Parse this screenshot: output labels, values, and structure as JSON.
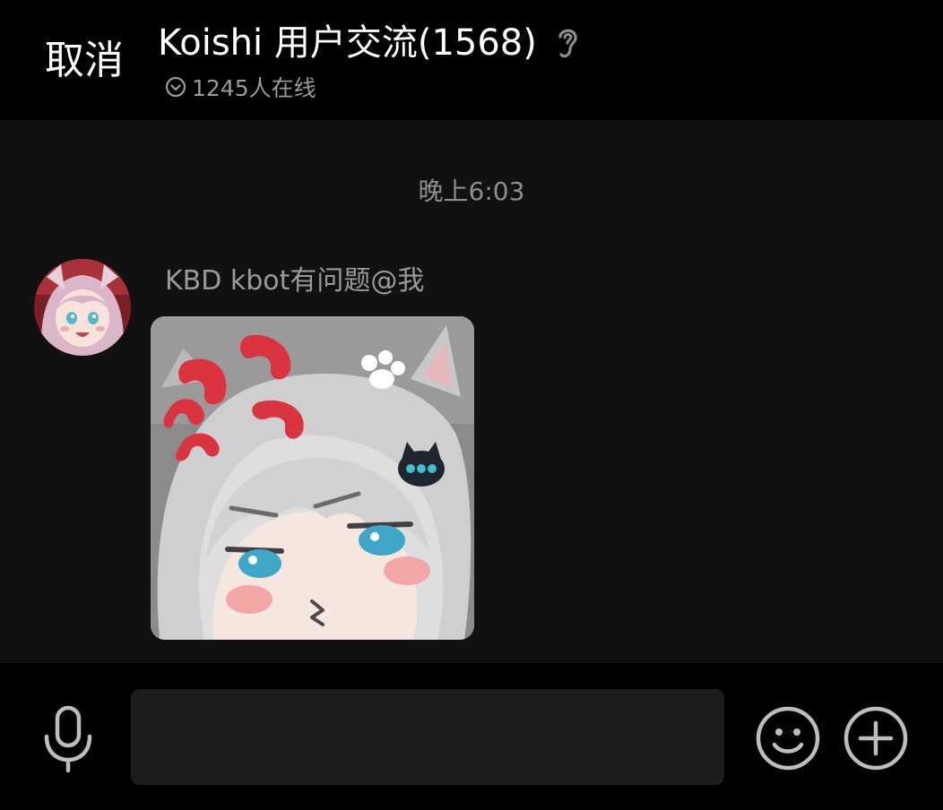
{
  "header": {
    "cancel_label": "取消",
    "group_title": "Koishi 用户交流(1568)",
    "online_text": "1245人在线",
    "icons": {
      "earpiece": "ear-icon",
      "online": "check-circle-icon"
    }
  },
  "chat": {
    "timestamp": "晚上6:03",
    "messages": [
      {
        "sender": "KBD kbot有问题@我",
        "avatar": "anime-girl-pink-hair",
        "content_type": "sticker",
        "sticker": "angry-anime-cat-girl"
      }
    ]
  },
  "input_bar": {
    "input_value": "",
    "icons": {
      "voice": "microphone-icon",
      "emoji": "smiley-icon",
      "more": "plus-circle-icon"
    }
  },
  "colors": {
    "header_bg": "#000000",
    "chat_bg": "#111111",
    "input_field_bg": "#1c1c1c",
    "secondary_text": "#9a9a9a",
    "icon_gray": "#bdbdbd",
    "anger_mark_red": "#d9343f",
    "eye_blue": "#3fa6c9"
  }
}
